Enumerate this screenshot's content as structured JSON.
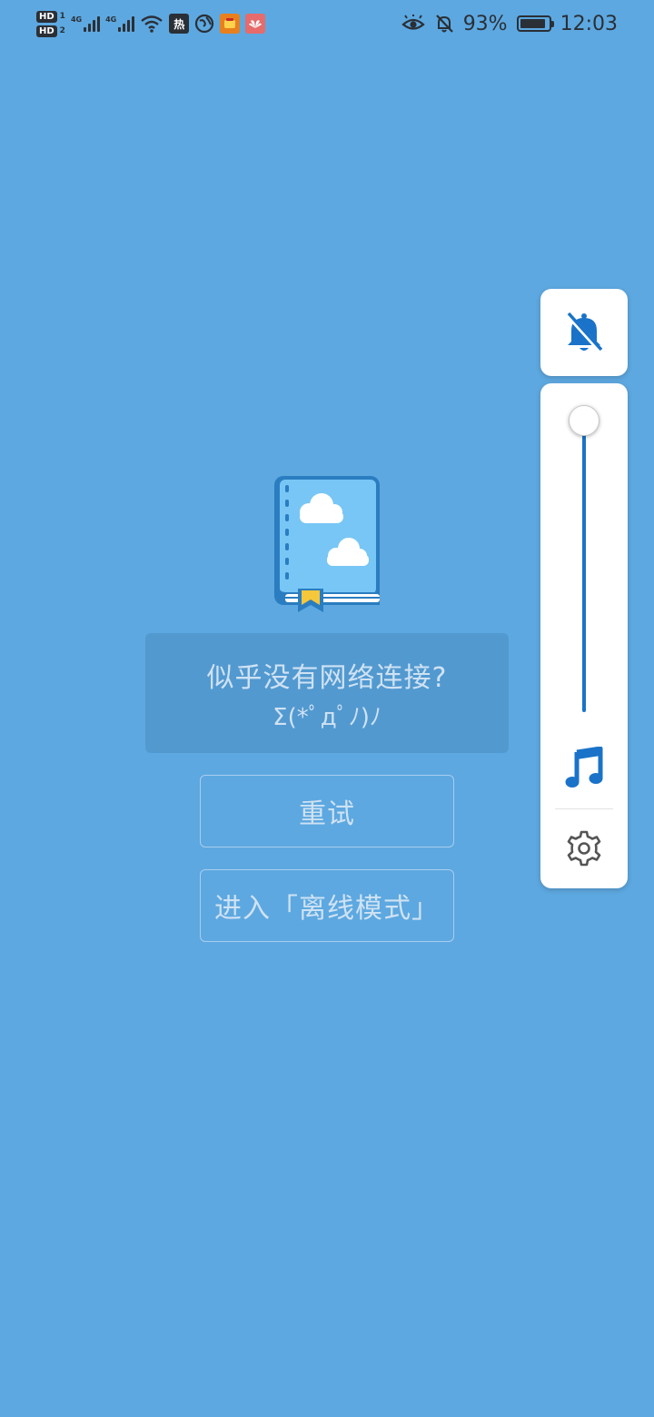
{
  "status_bar": {
    "hd1": "HD",
    "hd2": "HD",
    "sim1": "1",
    "sim2": "2",
    "net1": "4G",
    "net2": "4G",
    "hot_badge": "热",
    "battery_percent": "93%",
    "battery_level": 0.93,
    "time": "12:03"
  },
  "main": {
    "message_title": "似乎没有网络连接?",
    "message_face": "Σ(*ﾟдﾟﾉ)ﾉ",
    "retry_label": "重试",
    "offline_label": "进入「离线模式」"
  },
  "side_panel": {
    "bell_icon": "bell-off-icon",
    "slider_level": 1.0,
    "music_icon": "music-note-icon",
    "settings_icon": "gear-icon"
  },
  "colors": {
    "background": "#5DA8E0",
    "accent": "#1A73C9"
  }
}
